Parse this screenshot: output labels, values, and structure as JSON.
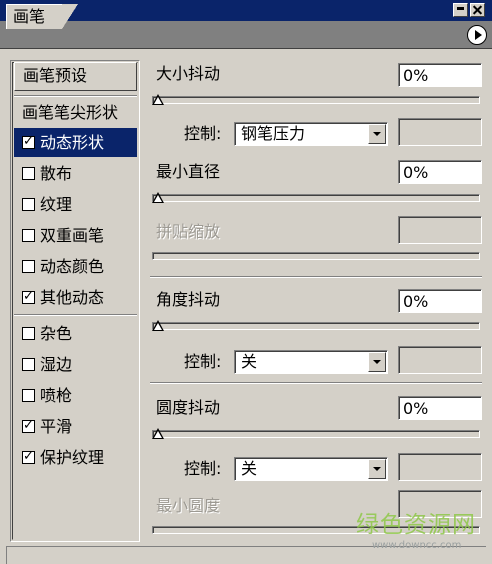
{
  "window": {
    "tab_label": "画笔"
  },
  "list": {
    "preset_button": "画笔预设",
    "items": [
      {
        "label": "画笔笔尖形状",
        "has_checkbox": false,
        "checked": false,
        "selected": false
      },
      {
        "label": "动态形状",
        "has_checkbox": true,
        "checked": true,
        "selected": true
      },
      {
        "label": "散布",
        "has_checkbox": true,
        "checked": false,
        "selected": false
      },
      {
        "label": "纹理",
        "has_checkbox": true,
        "checked": false,
        "selected": false
      },
      {
        "label": "双重画笔",
        "has_checkbox": true,
        "checked": false,
        "selected": false
      },
      {
        "label": "动态颜色",
        "has_checkbox": true,
        "checked": false,
        "selected": false
      },
      {
        "label": "其他动态",
        "has_checkbox": true,
        "checked": true,
        "selected": false
      },
      {
        "label": "杂色",
        "has_checkbox": true,
        "checked": false,
        "selected": false
      },
      {
        "label": "湿边",
        "has_checkbox": true,
        "checked": false,
        "selected": false
      },
      {
        "label": "喷枪",
        "has_checkbox": true,
        "checked": false,
        "selected": false
      },
      {
        "label": "平滑",
        "has_checkbox": true,
        "checked": true,
        "selected": false
      },
      {
        "label": "保护纹理",
        "has_checkbox": true,
        "checked": true,
        "selected": false
      }
    ]
  },
  "settings": {
    "size_jitter": {
      "label": "大小抖动",
      "value": "0%"
    },
    "size_control": {
      "label": "控制:",
      "value": "钢笔压力"
    },
    "min_diameter": {
      "label": "最小直径",
      "value": "0%"
    },
    "tilt_scale": {
      "label": "拼贴缩放"
    },
    "angle_jitter": {
      "label": "角度抖动",
      "value": "0%"
    },
    "angle_control": {
      "label": "控制:",
      "value": "关"
    },
    "roundness_jitter": {
      "label": "圆度抖动",
      "value": "0%"
    },
    "roundness_control": {
      "label": "控制:",
      "value": "关"
    },
    "min_roundness": {
      "label": "最小圆度"
    }
  },
  "watermark": {
    "text": "绿色资源网",
    "url": "www.downcc.com"
  }
}
